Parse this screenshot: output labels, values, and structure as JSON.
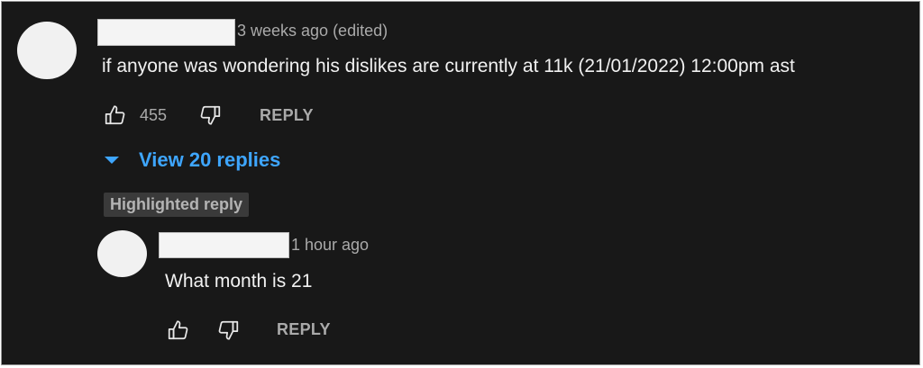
{
  "comment": {
    "timestamp": "3 weeks ago (edited)",
    "text": "if anyone was wondering his dislikes are currently at 11k  (21/01/2022) 12:00pm ast",
    "likes": "455",
    "reply_label": "REPLY",
    "view_replies_label": "View 20 replies"
  },
  "highlighted_label": "Highlighted reply",
  "reply": {
    "timestamp": "1 hour ago",
    "text": "What month is 21",
    "reply_label": "REPLY"
  },
  "icons": {
    "like": "thumbs-up-icon",
    "dislike": "thumbs-down-icon",
    "expand": "caret-down-icon"
  },
  "colors": {
    "background": "#181818",
    "link": "#3ea6ff",
    "secondary_text": "#aaaaaa",
    "primary_text": "#f1f1f1"
  }
}
